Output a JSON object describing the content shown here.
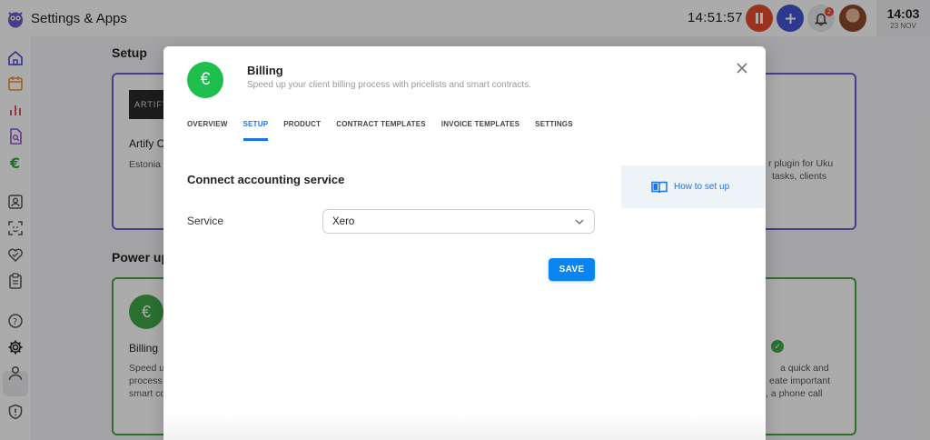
{
  "app": {
    "title": "Settings & Apps",
    "timer": "14:51:57",
    "notification_count": "2",
    "clock_time": "14:03",
    "clock_date": "23 NOV"
  },
  "background": {
    "setup_title": "Setup",
    "artify_logo": "ARTIFY",
    "artify_name": "Artify C",
    "artify_desc": "Estonia",
    "uku_desc_line1": "r plugin for Uku",
    "uku_desc_line2": "tasks, clients",
    "power_title": "Power up",
    "billing_name": "Billing",
    "billing_desc_lines": [
      "Speed u",
      "process",
      "smart co"
    ],
    "right_desc_lines": [
      "a quick and",
      "eate important",
      "ple, a phone call"
    ]
  },
  "modal": {
    "icon": "euro-icon",
    "title": "Billing",
    "subtitle": "Speed up your client billing process with pricelists and smart contracts.",
    "tabs": [
      {
        "label": "OVERVIEW",
        "active": false
      },
      {
        "label": "SETUP",
        "active": true
      },
      {
        "label": "PRODUCT",
        "active": false
      },
      {
        "label": "CONTRACT TEMPLATES",
        "active": false
      },
      {
        "label": "INVOICE TEMPLATES",
        "active": false
      },
      {
        "label": "SETTINGS",
        "active": false
      }
    ],
    "section_title": "Connect accounting service",
    "service_label": "Service",
    "service_value": "Xero",
    "save_label": "SAVE",
    "help_link": "How to set up"
  },
  "colors": {
    "accent": "#1a73e8",
    "billing_green": "#1fbf4e",
    "pause_red": "#e84a2f",
    "add_blue": "#4356d6"
  }
}
